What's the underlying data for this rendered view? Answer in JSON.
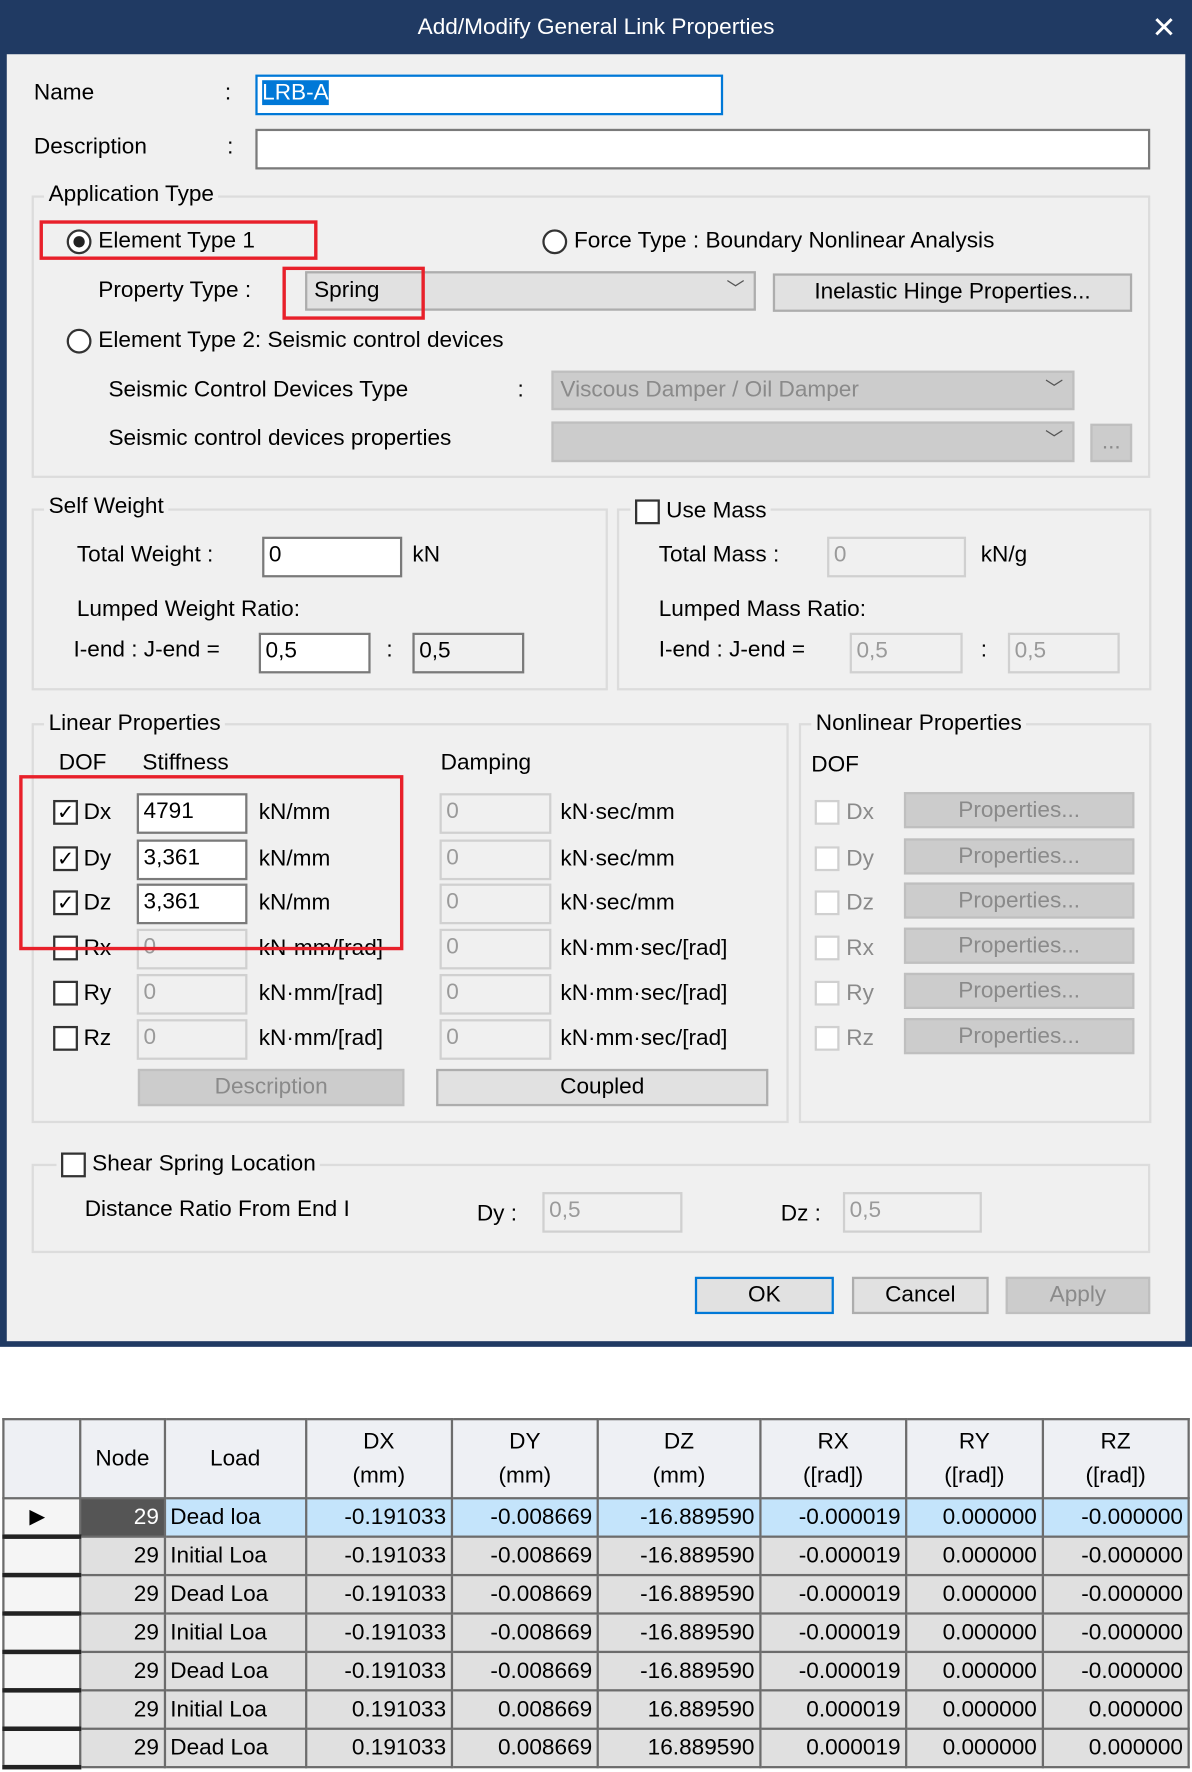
{
  "dialog": {
    "title": "Add/Modify General Link Properties",
    "close_icon": "close-x",
    "name_label": "Name",
    "name_value": "LRB-A",
    "description_label": "Description",
    "description_value": "",
    "colon": ":",
    "application_type": {
      "legend": "Application Type",
      "element_type1": "Element Type 1",
      "element_type1_selected": true,
      "force_type": "Force Type : Boundary Nonlinear Analysis",
      "property_type_label": "Property Type :",
      "property_type_value": "Spring",
      "inelastic_button": "Inelastic Hinge Properties...",
      "element_type2": "Element Type 2: Seismic control devices",
      "scd_type_label": "Seismic Control Devices Type",
      "scd_type_value": "Viscous Damper / Oil Damper",
      "scd_props_label": "Seismic control devices properties",
      "scd_props_value": "",
      "ellipsis_button": "..."
    },
    "self_weight": {
      "legend": "Self Weight",
      "total_weight_label": "Total Weight :",
      "total_weight": "0",
      "unit": "kN",
      "lumped_label": "Lumped Weight Ratio:",
      "ij_label": "I-end : J-end =",
      "i_ratio": "0,5",
      "j_ratio": "0,5"
    },
    "use_mass": {
      "legend": "Use Mass",
      "checked": false,
      "total_mass_label": "Total Mass :",
      "total_mass": "0",
      "unit": "kN/g",
      "lumped_label": "Lumped Mass Ratio:",
      "ij_label": "I-end : J-end =",
      "i_ratio": "0,5",
      "j_ratio": "0,5"
    },
    "linear": {
      "legend": "Linear Properties",
      "dof_header": "DOF",
      "stiffness_header": "Stiffness",
      "damping_header": "Damping",
      "rows": [
        {
          "dof": "Dx",
          "checked": true,
          "stiffness": "4791",
          "stiff_unit": "kN/mm",
          "damping": "0",
          "damp_unit": "kN·sec/mm"
        },
        {
          "dof": "Dy",
          "checked": true,
          "stiffness": "3,361",
          "stiff_unit": "kN/mm",
          "damping": "0",
          "damp_unit": "kN·sec/mm"
        },
        {
          "dof": "Dz",
          "checked": true,
          "stiffness": "3,361",
          "stiff_unit": "kN/mm",
          "damping": "0",
          "damp_unit": "kN·sec/mm"
        },
        {
          "dof": "Rx",
          "checked": false,
          "stiffness": "0",
          "stiff_unit": "kN·mm/[rad]",
          "damping": "0",
          "damp_unit": "kN·mm·sec/[rad]"
        },
        {
          "dof": "Ry",
          "checked": false,
          "stiffness": "0",
          "stiff_unit": "kN·mm/[rad]",
          "damping": "0",
          "damp_unit": "kN·mm·sec/[rad]"
        },
        {
          "dof": "Rz",
          "checked": false,
          "stiffness": "0",
          "stiff_unit": "kN·mm/[rad]",
          "damping": "0",
          "damp_unit": "kN·mm·sec/[rad]"
        }
      ],
      "description_button": "Description",
      "coupled_button": "Coupled"
    },
    "nonlinear": {
      "legend": "Nonlinear Properties",
      "dof_header": "DOF",
      "rows": [
        {
          "dof": "Dx",
          "button": "Properties..."
        },
        {
          "dof": "Dy",
          "button": "Properties..."
        },
        {
          "dof": "Dz",
          "button": "Properties..."
        },
        {
          "dof": "Rx",
          "button": "Properties..."
        },
        {
          "dof": "Ry",
          "button": "Properties..."
        },
        {
          "dof": "Rz",
          "button": "Properties..."
        }
      ]
    },
    "shear_spring": {
      "legend": "Shear Spring Location",
      "checked": false,
      "distance_label": "Distance Ratio From End I",
      "dy_label": "Dy :",
      "dy": "0,5",
      "dz_label": "Dz :",
      "dz": "0,5"
    },
    "buttons": {
      "ok": "OK",
      "cancel": "Cancel",
      "apply": "Apply"
    },
    "highlight_color": "#e8202a"
  },
  "table": {
    "headers": [
      [
        "",
        ""
      ],
      [
        "Node",
        ""
      ],
      [
        "Load",
        ""
      ],
      [
        "DX",
        "(mm)"
      ],
      [
        "DY",
        "(mm)"
      ],
      [
        "DZ",
        "(mm)"
      ],
      [
        "RX",
        "([rad])"
      ],
      [
        "RY",
        "([rad])"
      ],
      [
        "RZ",
        "([rad])"
      ]
    ],
    "rows": [
      [
        "29",
        "Dead loa",
        "-0.191033",
        "-0.008669",
        "-16.889590",
        "-0.000019",
        "0.000000",
        "-0.000000"
      ],
      [
        "29",
        "Initial Loa",
        "-0.191033",
        "-0.008669",
        "-16.889590",
        "-0.000019",
        "0.000000",
        "-0.000000"
      ],
      [
        "29",
        "Dead Loa",
        "-0.191033",
        "-0.008669",
        "-16.889590",
        "-0.000019",
        "0.000000",
        "-0.000000"
      ],
      [
        "29",
        "Initial Loa",
        "-0.191033",
        "-0.008669",
        "-16.889590",
        "-0.000019",
        "0.000000",
        "-0.000000"
      ],
      [
        "29",
        "Dead Loa",
        "-0.191033",
        "-0.008669",
        "-16.889590",
        "-0.000019",
        "0.000000",
        "-0.000000"
      ],
      [
        "29",
        "Initial Loa",
        "0.191033",
        "0.008669",
        "16.889590",
        "0.000019",
        "0.000000",
        "0.000000"
      ],
      [
        "29",
        "Dead Loa",
        "0.191033",
        "0.008669",
        "16.889590",
        "0.000019",
        "0.000000",
        "0.000000"
      ]
    ],
    "selected_row": 0
  }
}
